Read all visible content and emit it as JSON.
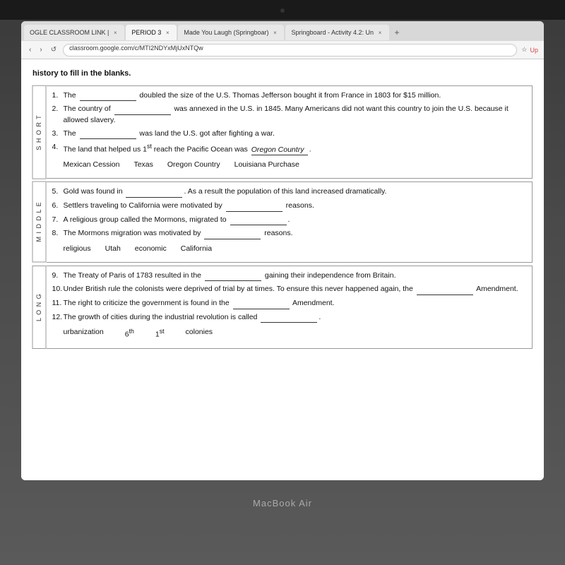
{
  "desktop": {
    "macbook_label": "MacBook Air"
  },
  "browser": {
    "tabs": [
      {
        "label": "OGLE CLASSROOM LINK |",
        "active": false
      },
      {
        "label": "PERIOD 3",
        "active": true
      },
      {
        "label": "Made You Laugh (Springboar)",
        "active": false
      },
      {
        "label": "Springboard - Activity 4.2: Un",
        "active": false
      }
    ],
    "add_tab": "+",
    "address": "classroom.google.com/c/MTI2NDYxMjUxNTQw",
    "bookmark_star": "☆",
    "bookmark_ext": "★",
    "nav_back": "‹",
    "nav_forward": "›",
    "nav_refresh": "↺"
  },
  "content": {
    "header": "history to fill in the blanks.",
    "short_section_label": "S\nH\nO\nR\nT",
    "section1_questions": [
      {
        "num": "1.",
        "text_before": "The ",
        "blank": "",
        "text_after": " doubled the size of the U.S.  Thomas Jefferson bought it from France in 1803 for $15 million."
      },
      {
        "num": "2.",
        "text_before": "The country of ",
        "blank": "",
        "text_after": " was annexed in the U.S. in 1845. Many Americans did not want this country to join the U.S. because it allowed slavery."
      },
      {
        "num": "3.",
        "text_before": "The ",
        "blank": "",
        "text_after": " was land the U.S. got after fighting a war."
      },
      {
        "num": "4.",
        "text_before": "The land that helped us 1",
        "super": "st",
        "text_after": " reach the Pacific Ocean was ",
        "blank2": "",
        "text_end": "."
      }
    ],
    "wordbank1": [
      "Mexican Cession",
      "Texas",
      "Oregon Country",
      "Louisiana Purchase"
    ],
    "mid_section_label": "M\nI\nD\nD\nL\nE",
    "section2_questions": [
      {
        "num": "5.",
        "text_before": "Gold was found in ",
        "blank": "",
        "text_after": ".  As a result the population of this land increased dramatically."
      },
      {
        "num": "6.",
        "text_before": "Settlers traveling to California were motivated by ",
        "blank": "",
        "text_after": " reasons."
      },
      {
        "num": "7.",
        "text_before": "A religious group called the Mormons, migrated to ",
        "blank": "",
        "text_after": "."
      },
      {
        "num": "8.",
        "text_before": "The Mormons migration was motivated by ",
        "blank": "",
        "text_after": " reasons."
      }
    ],
    "wordbank2": [
      "religious",
      "Utah",
      "economic",
      "California"
    ],
    "long_section_label": "L\nO\nN\nG",
    "section3_questions": [
      {
        "num": "9.",
        "text_before": "The Treaty of Paris of 1783 resulted in the ",
        "blank": "",
        "text_after": " gaining their independence from Britain."
      },
      {
        "num": "10.",
        "text_before": "Under British rule the colonists were deprived of trial by at times.  To ensure this never happened again, the ",
        "blank": "",
        "text_after": " Amendment."
      },
      {
        "num": "11.",
        "text_before": "The right to criticize the government is found in the ",
        "blank": "",
        "text_after": " Amendment."
      },
      {
        "num": "12.",
        "text_before": "The growth of cities during the industrial revolution is called ",
        "blank": "",
        "text_after": "."
      }
    ],
    "wordbank3": [
      "urbanization",
      "6th",
      "1st",
      "colonies"
    ]
  }
}
